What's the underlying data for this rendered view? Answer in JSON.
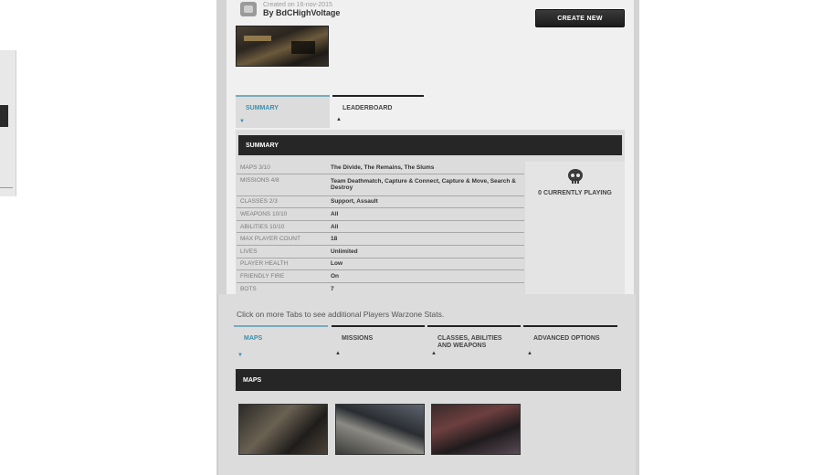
{
  "header": {
    "created_on": "Created on 16-nov-2015",
    "author": "By BdCHighVoltage",
    "create_button": "CREATE NEW"
  },
  "top_tabs": [
    {
      "label": "SUMMARY",
      "active": true
    },
    {
      "label": "LEADERBOARD",
      "active": false
    }
  ],
  "summary": {
    "title": "SUMMARY",
    "rows": [
      {
        "key": "MAPS 3/10",
        "value": "The Divide, The Remains, The Slums"
      },
      {
        "key": "MISSIONS 4/8",
        "value": "Team Deathmatch, Capture & Connect, Capture & Move, Search & Destroy"
      },
      {
        "key": "CLASSES 2/3",
        "value": "Support, Assault"
      },
      {
        "key": "WEAPONS 10/10",
        "value": "All"
      },
      {
        "key": "ABILITIES 10/10",
        "value": "All"
      },
      {
        "key": "MAX PLAYER COUNT",
        "value": "18"
      },
      {
        "key": "LIVES",
        "value": "Unlimited"
      },
      {
        "key": "PLAYER HEALTH",
        "value": "Low"
      },
      {
        "key": "FRIENDLY FIRE",
        "value": "On"
      },
      {
        "key": "BOTS",
        "value": "7"
      }
    ],
    "playing": "0 CURRENTLY PLAYING"
  },
  "hint": "Click on more Tabs to see additional Players Warzone Stats.",
  "bottom_tabs": [
    {
      "label": "MAPS",
      "active": true
    },
    {
      "label": "MISSIONS",
      "active": false
    },
    {
      "label": "CLASSES, ABILITIES AND WEAPONS",
      "active": false
    },
    {
      "label": "ADVANCED OPTIONS",
      "active": false
    }
  ],
  "maps_section": {
    "title": "MAPS"
  },
  "icons": {
    "creator": "controller-icon",
    "playing": "skull-icon",
    "tab_arrow": "triangle-up-icon"
  },
  "colors": {
    "accent": "#3a8fb0",
    "bar": "#262626"
  }
}
